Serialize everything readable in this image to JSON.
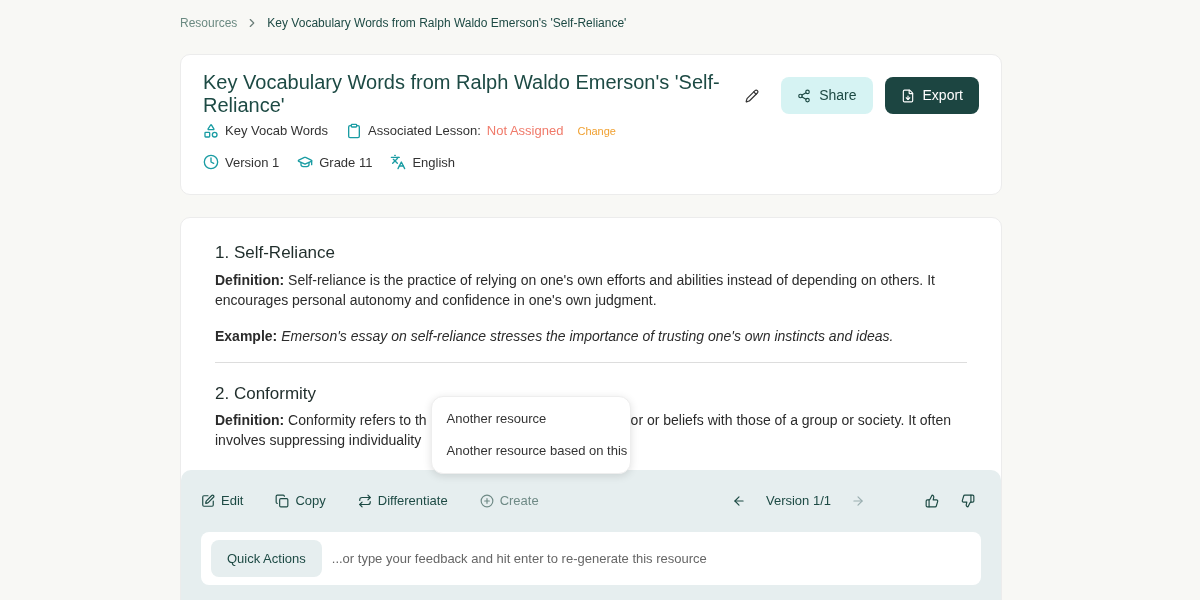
{
  "breadcrumb": [
    {
      "label": "Resources",
      "current": false
    },
    {
      "label": "Key Vocabulary Words from Ralph Waldo Emerson's 'Self-Reliance'",
      "current": true
    }
  ],
  "header": {
    "title": "Key Vocabulary Words from Ralph Waldo Emerson's 'Self-Reliance'",
    "type": "Key Vocab Words",
    "lesson_label": "Associated Lesson:",
    "lesson_value": "Not Assigned",
    "change": "Change",
    "version": "Version 1",
    "grade": "Grade 11",
    "language": "English",
    "share": "Share",
    "export": "Export"
  },
  "terms": [
    {
      "heading": "1. Self-Reliance",
      "definition_label": "Definition:",
      "definition": [
        "Self-reliance is the practice of relying on one's own efforts and abilities instead of depending on others. It encourages personal autonomy and confidence in one's own judgment."
      ],
      "example_label": "Example:",
      "example": "Emerson's essay on self-reliance stresses the importance of trusting one's own instincts and ideas."
    },
    {
      "heading": "2. Conformity",
      "definition_label": "Definition:",
      "definition": [
        "Conformity refers to th",
        "or or beliefs with those of a group or society. It often",
        "involves suppressing individuality"
      ]
    }
  ],
  "popup_menu": [
    {
      "label": "Another resource"
    },
    {
      "label": "Another resource based on this"
    }
  ],
  "toolbar": [
    {
      "label": "Edit",
      "kind": "edit",
      "disabled": false
    },
    {
      "label": "Copy",
      "kind": "copy",
      "disabled": false
    },
    {
      "label": "Differentiate",
      "kind": "differentiate",
      "disabled": false
    },
    {
      "label": "Create",
      "kind": "create",
      "disabled": true
    }
  ],
  "version_nav": {
    "label": "Version 1/1",
    "prev_disabled": false,
    "next_disabled": true
  },
  "feedback": {
    "quick_actions": "Quick Actions",
    "placeholder": "...or type your feedback and hit enter to re-generate this resource"
  }
}
